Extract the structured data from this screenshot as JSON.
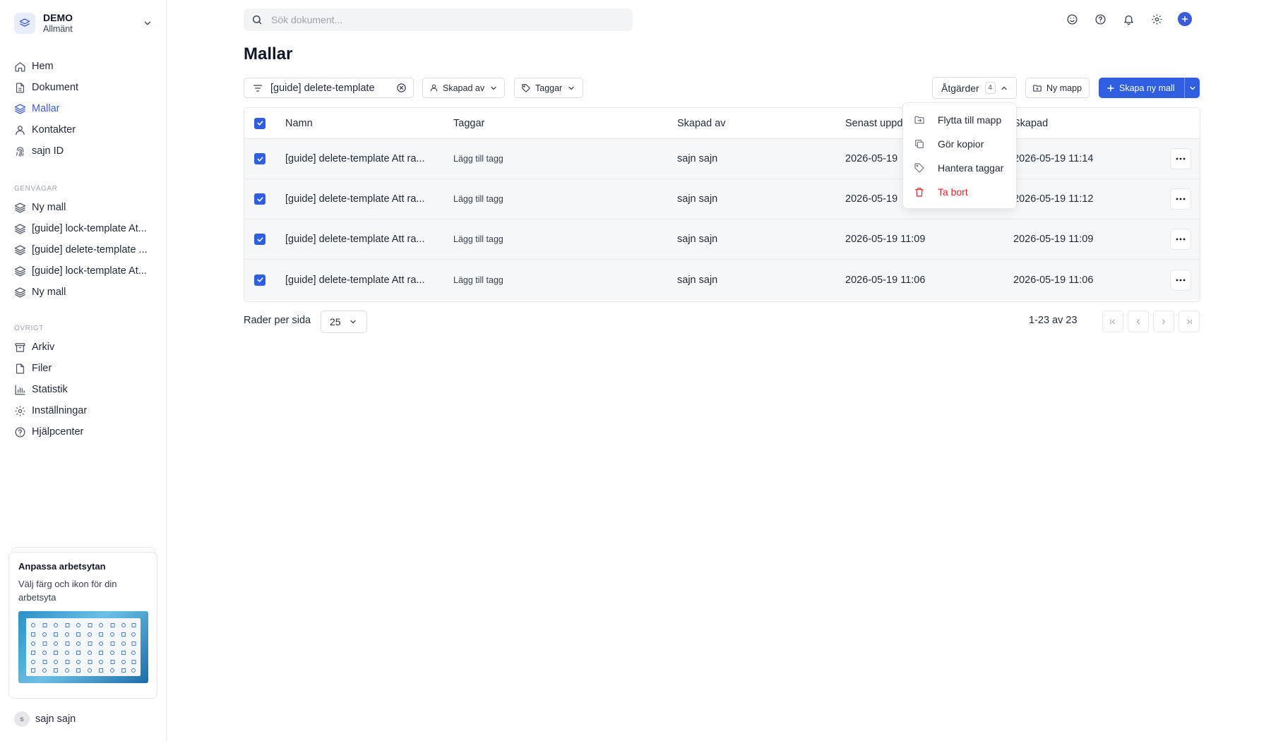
{
  "workspace": {
    "name": "DEMO",
    "subtitle": "Allmänt"
  },
  "nav": [
    {
      "label": "Hem",
      "icon": "home-icon"
    },
    {
      "label": "Dokument",
      "icon": "document-icon"
    },
    {
      "label": "Mallar",
      "icon": "layers-icon",
      "active": true
    },
    {
      "label": "Kontakter",
      "icon": "user-icon"
    },
    {
      "label": "sajn ID",
      "icon": "fingerprint-icon"
    }
  ],
  "shortcuts": {
    "heading": "GENVÄGAR",
    "items": [
      {
        "label": "Ny mall"
      },
      {
        "label": "[guide] lock-template At..."
      },
      {
        "label": "[guide] delete-template ..."
      },
      {
        "label": "[guide] lock-template At..."
      },
      {
        "label": "Ny mall"
      }
    ]
  },
  "other": {
    "heading": "ÖVRIGT",
    "items": [
      {
        "label": "Arkiv",
        "icon": "archive-icon"
      },
      {
        "label": "Filer",
        "icon": "file-icon"
      },
      {
        "label": "Statistik",
        "icon": "bar-chart-icon"
      },
      {
        "label": "Inställningar",
        "icon": "gear-icon"
      },
      {
        "label": "Hjälpcenter",
        "icon": "help-circle-icon"
      }
    ]
  },
  "promo": {
    "title": "Anpassa arbetsytan",
    "body": "Välj färg och ikon för din arbetsyta"
  },
  "user": {
    "initial": "s",
    "name": "sajn sajn"
  },
  "search": {
    "placeholder": "Sök dokument..."
  },
  "page_title": "Mallar",
  "toolbar": {
    "filter_value": "[guide] delete-template",
    "created_by_label": "Skapad av",
    "tags_label": "Taggar",
    "actions_label": "Åtgärder",
    "actions_count": "4",
    "new_folder_label": "Ny mapp",
    "create_label": "Skapa ny mall"
  },
  "table": {
    "headers": {
      "name": "Namn",
      "tags": "Taggar",
      "created_by": "Skapad av",
      "updated": "Senast uppd",
      "created": "Skapad"
    },
    "rows": [
      {
        "name": "[guide] delete-template Att ra...",
        "tags": "Lägg till tagg",
        "created_by": "sajn sajn",
        "updated": "2026-05-19",
        "created": "2026-05-19 11:14",
        "selected": true
      },
      {
        "name": "[guide] delete-template Att ra...",
        "tags": "Lägg till tagg",
        "created_by": "sajn sajn",
        "updated": "2026-05-19",
        "created": "2026-05-19 11:12",
        "selected": true
      },
      {
        "name": "[guide] delete-template Att ra...",
        "tags": "Lägg till tagg",
        "created_by": "sajn sajn",
        "updated": "2026-05-19 11:09",
        "created": "2026-05-19 11:09",
        "selected": true
      },
      {
        "name": "[guide] delete-template Att ra...",
        "tags": "Lägg till tagg",
        "created_by": "sajn sajn",
        "updated": "2026-05-19 11:06",
        "created": "2026-05-19 11:06",
        "selected": true
      }
    ]
  },
  "footer": {
    "rows_per_page_label": "Rader per sida",
    "rows_per_page_value": "25",
    "range": "1-23 av 23"
  },
  "actions_menu": [
    {
      "label": "Flytta till mapp",
      "icon": "folder-move-icon"
    },
    {
      "label": "Gör kopior",
      "icon": "copy-icon"
    },
    {
      "label": "Hantera taggar",
      "icon": "tag-icon"
    },
    {
      "label": "Ta bort",
      "icon": "trash-icon",
      "danger": true
    }
  ],
  "colors": {
    "accent": "#2f5fe0",
    "danger": "#dc2626",
    "active_nav": "#3b5bdb"
  }
}
